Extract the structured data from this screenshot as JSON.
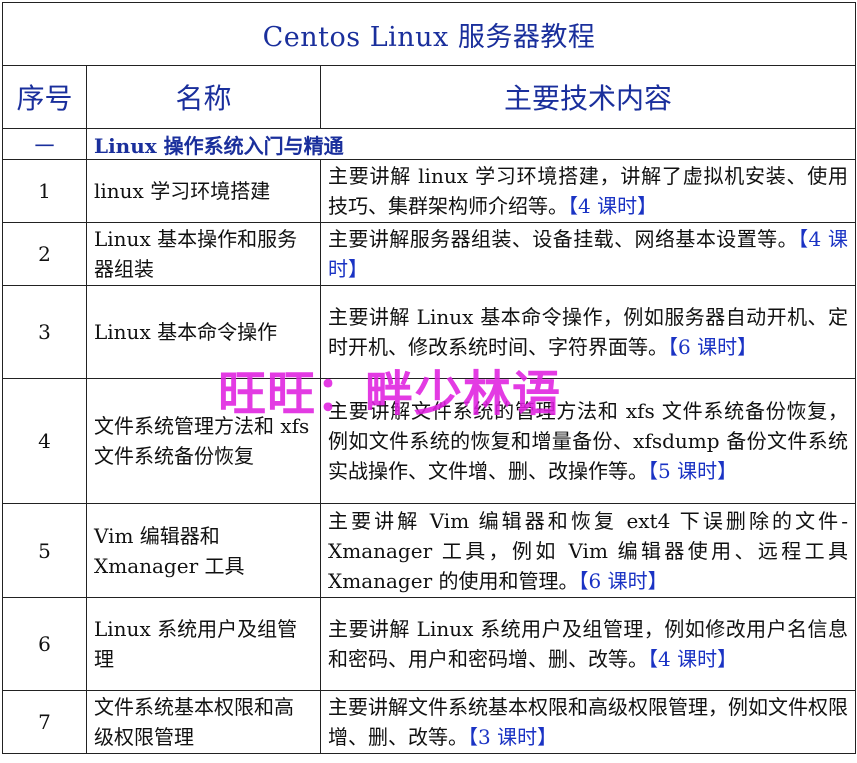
{
  "title": "Centos Linux 服务器教程",
  "headers": {
    "num": "序号",
    "name": "名称",
    "content": "主要技术内容"
  },
  "section": {
    "num": "一",
    "title": "Linux 操作系统入门与精通"
  },
  "rows": [
    {
      "num": "1",
      "name": "linux 学习环境搭建",
      "desc": "主要讲解 linux 学习环境搭建，讲解了虚拟机安装、使用技巧、集群架构师介绍等。",
      "hours": "【4 课时】"
    },
    {
      "num": "2",
      "name": "Linux 基本操作和服务器组装",
      "desc": "主要讲解服务器组装、设备挂载、网络基本设置等。",
      "hours": "【4 课时】"
    },
    {
      "num": "3",
      "name": "Linux 基本命令操作",
      "desc": "主要讲解 Linux 基本命令操作，例如服务器自动开机、定时开机、修改系统时间、字符界面等。",
      "hours": "【6 课时】"
    },
    {
      "num": "4",
      "name": "文件系统管理方法和 xfs 文件系统备份恢复",
      "desc": "主要讲解文件系统的管理方法和 xfs 文件系统备份恢复，例如文件系统的恢复和增量备份、xfsdump 备份文件系统实战操作、文件增、删、改操作等。",
      "hours": "【5 课时】"
    },
    {
      "num": "5",
      "name": "Vim 编辑器和 Xmanager 工具",
      "desc": "主要讲解 Vim 编辑器和恢复 ext4 下误删除的文件-Xmanager 工具，例如 Vim 编辑器使用、远程工具 Xmanager 的使用和管理。",
      "hours": "【6 课时】"
    },
    {
      "num": "6",
      "name": "Linux 系统用户及组管理",
      "desc": "主要讲解 Linux 系统用户及组管理，例如修改用户名信息和密码、用户和密码增、删、改等。",
      "hours": "【4 课时】"
    },
    {
      "num": "7",
      "name": "文件系统基本权限和高级权限管理",
      "desc": "主要讲解文件系统基本权限和高级权限管理，例如文件权限增、删、改等。",
      "hours": "【3 课时】"
    }
  ],
  "watermark": "旺旺：畔少林语"
}
